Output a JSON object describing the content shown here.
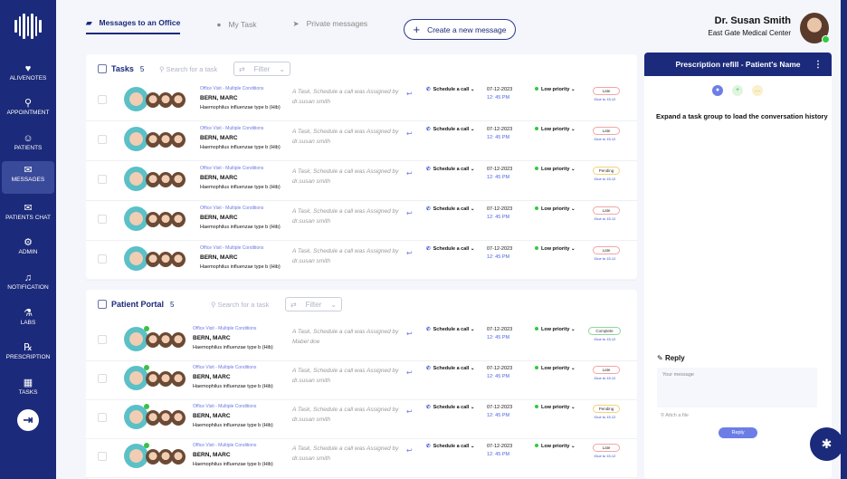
{
  "sidebar": {
    "items": [
      {
        "label": "ALIVENOTES",
        "icon": "♥"
      },
      {
        "label": "APPOINTMENT",
        "icon": "⚲"
      },
      {
        "label": "PATIENTS",
        "icon": "☺"
      },
      {
        "label": "MESSAGES",
        "icon": "✉"
      },
      {
        "label": "PATIENTS CHAT",
        "icon": "✉"
      },
      {
        "label": "ADMIN",
        "icon": "⚙"
      },
      {
        "label": "NOTIFICATION",
        "icon": "♫"
      },
      {
        "label": "LABS",
        "icon": "⚗"
      },
      {
        "label": "PRESCRIPTION",
        "icon": "℞"
      },
      {
        "label": "TASKS",
        "icon": "▦"
      }
    ],
    "logout_icon": "⇥"
  },
  "tabs": [
    {
      "label": "Messages to an Office",
      "icon": "▰"
    },
    {
      "label": "My Task",
      "icon": "●"
    },
    {
      "label": "Private messages",
      "icon": "➤"
    }
  ],
  "create_label": "Create a new message",
  "user": {
    "name": "Dr. Susan Smith",
    "org": "East Gate Medical Center"
  },
  "tasks": {
    "title": "Tasks",
    "count": "5",
    "search": "Search for a task",
    "filter": "Filter",
    "rows": [
      {
        "cat": "Office Visit - Multiple Conditions",
        "name": "BERN, MARC",
        "diag": "Haemophilus influenzae type b (Hib)",
        "assign": "A Task, Schedule a call was Assigned by dr.susan smith",
        "action": "Schedule a call",
        "date": "07-12-2023",
        "time": "12: 45 PM",
        "prio": "Low priority",
        "status": "Late",
        "due": "Due to 15.12"
      },
      {
        "cat": "Office Visit - Multiple Conditions",
        "name": "BERN, MARC",
        "diag": "Haemophilus influenzae type b (Hib)",
        "assign": "A Task, Schedule a call was Assigned by dr.susan smith",
        "action": "Schedule a call",
        "date": "07-12-2023",
        "time": "12: 45 PM",
        "prio": "Low priority",
        "status": "Late",
        "due": "Due to 15.12"
      },
      {
        "cat": "Office Visit - Multiple Conditions",
        "name": "BERN, MARC",
        "diag": "Haemophilus influenzae type b (Hib)",
        "assign": "A Task, Schedule a call was Assigned by dr.susan smith",
        "action": "Schedule a call",
        "date": "07-12-2023",
        "time": "12: 45 PM",
        "prio": "Low priority",
        "status": "Pending",
        "due": "Due to 15.12"
      },
      {
        "cat": "Office Visit - Multiple Conditions",
        "name": "BERN, MARC",
        "diag": "Haemophilus influenzae type b (Hib)",
        "assign": "A Task, Schedule a call was Assigned by dr.susan smith",
        "action": "Schedule a call",
        "date": "07-12-2023",
        "time": "12: 45 PM",
        "prio": "Low priority",
        "status": "Late",
        "due": "Due to 15.12"
      },
      {
        "cat": "Office Visit - Multiple Conditions",
        "name": "BERN, MARC",
        "diag": "Haemophilus influenzae type b (Hib)",
        "assign": "A Task, Schedule a call was Assigned by dr.susan smith",
        "action": "Schedule a call",
        "date": "07-12-2023",
        "time": "12: 45 PM",
        "prio": "Low priority",
        "status": "Late",
        "due": "Due to 15.12"
      }
    ]
  },
  "portal": {
    "title": "Patient Portal",
    "count": "5",
    "search": "Search for a task",
    "filter": "Filter",
    "rows": [
      {
        "cat": "Office Visit - Multiple Conditions",
        "name": "BERN, MARC",
        "diag": "Haemophilus influenzae type b (Hib)",
        "assign": "A Task, Schedule a call was Assigned by Mabel doe",
        "action": "Schedule a call",
        "date": "07-12-2023",
        "time": "12: 45 PM",
        "prio": "Low priority",
        "status": "Complete",
        "due": "Due to 15.12"
      },
      {
        "cat": "Office Visit - Multiple Conditions",
        "name": "BERN, MARC",
        "diag": "Haemophilus influenzae type b (Hib)",
        "assign": "A Task, Schedule a call was Assigned by dr.susan smith",
        "action": "Schedule a call",
        "date": "07-12-2023",
        "time": "12: 45 PM",
        "prio": "Low priority",
        "status": "Late",
        "due": "Due to 15.12"
      },
      {
        "cat": "Office Visit - Multiple Conditions",
        "name": "BERN, MARC",
        "diag": "Haemophilus influenzae type b (Hib)",
        "assign": "A Task, Schedule a call was Assigned by dr.susan smith",
        "action": "Schedule a call",
        "date": "07-12-2023",
        "time": "12: 45 PM",
        "prio": "Low priority",
        "status": "Pending",
        "due": "Due to 15.12"
      },
      {
        "cat": "Office Visit - Multiple Conditions",
        "name": "BERN, MARC",
        "diag": "Haemophilus influenzae type b (Hib)",
        "assign": "A Task, Schedule a call was Assigned by dr.susan smith",
        "action": "Schedule a call",
        "date": "07-12-2023",
        "time": "12: 45 PM",
        "prio": "Low priority",
        "status": "Late",
        "due": "Due to 15.12"
      }
    ]
  },
  "panel": {
    "title": "Prescription refill - Patient's Name",
    "hint": "Expand a task group to load the conversation history",
    "reply_label": "Reply",
    "placeholder": "Your message",
    "attach": "Attch a file",
    "reply_button": "Reply"
  }
}
